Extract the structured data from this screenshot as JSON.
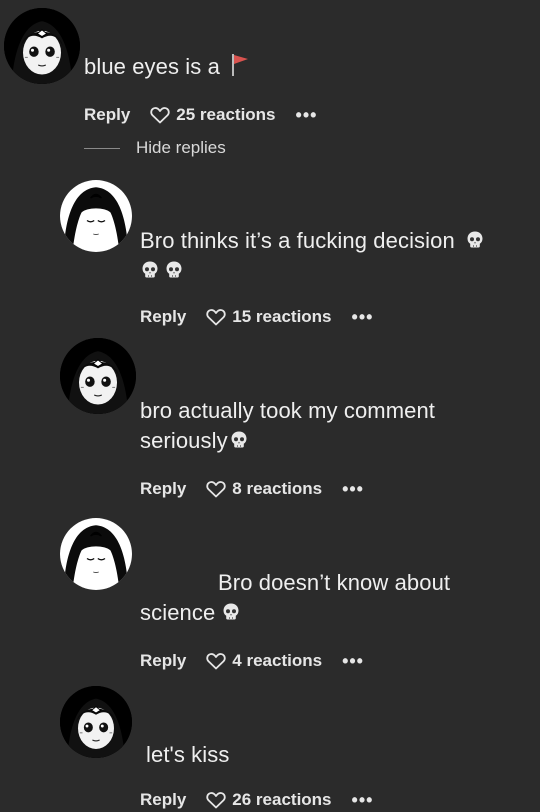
{
  "hide_replies_label": "Hide replies",
  "comments": [
    {
      "text": "blue eyes is a",
      "emoji": "red-flag-icon",
      "reply_label": "Reply",
      "reactions": "25 reactions",
      "more": "•••"
    },
    {
      "text": "Bro thinks it’s a fucking decision",
      "emoji": "skull-icon",
      "reply_label": "Reply",
      "reactions": "15 reactions",
      "more": "•••"
    },
    {
      "text_line1": "bro actually took my comment",
      "text_line2": "seriously",
      "emoji": "skull-icon",
      "reply_label": "Reply",
      "reactions": "8 reactions",
      "more": "•••"
    },
    {
      "text_line1": "Bro doesn’t know about",
      "text_line2": "science",
      "emoji": "skull-icon",
      "reply_label": "Reply",
      "reactions": "4 reactions",
      "more": "•••"
    },
    {
      "text": "let's kiss",
      "reply_label": "Reply",
      "reactions": "26 reactions",
      "more": "•••"
    }
  ],
  "colors": {
    "background": "#2b2b2b",
    "text": "#efefef",
    "flag": "#d9534f"
  }
}
